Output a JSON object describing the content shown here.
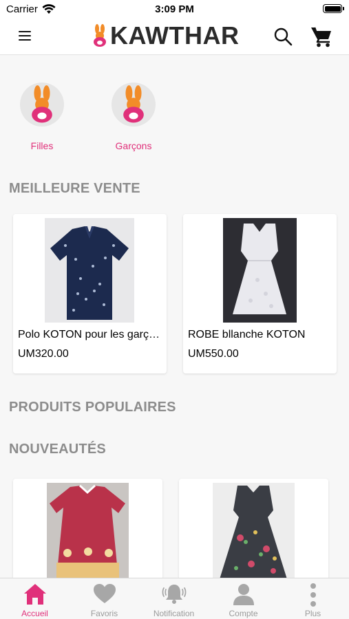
{
  "status_bar": {
    "carrier": "Carrier",
    "time": "3:09 PM"
  },
  "header": {
    "brand": "KAWTHAR",
    "menu_icon": "hamburger-menu-icon",
    "search_icon": "search-icon",
    "cart_icon": "cart-icon"
  },
  "categories": [
    {
      "label": "Filles",
      "icon": "bunny-logo-icon"
    },
    {
      "label": "Garçons",
      "icon": "bunny-logo-icon"
    }
  ],
  "sections": {
    "best_sellers": "MEILLEURE VENTE",
    "popular": "PRODUITS POPULAIRES",
    "new_arrivals": "NOUVEAUTÉS"
  },
  "best_sellers": [
    {
      "title": "Polo KOTON pour les garçons",
      "price": "UM320.00",
      "image": "navy-polo-shirt"
    },
    {
      "title": "ROBE bllanche  KOTON",
      "price": "UM550.00",
      "image": "white-dress"
    }
  ],
  "new_arrivals": [
    {
      "image": "red-girls-dress"
    },
    {
      "image": "floral-dark-dress"
    }
  ],
  "tab_bar": [
    {
      "label": "Accueil",
      "icon": "home-icon",
      "active": true
    },
    {
      "label": "Favoris",
      "icon": "heart-icon",
      "active": false
    },
    {
      "label": "Notification",
      "icon": "bell-icon",
      "active": false
    },
    {
      "label": "Compte",
      "icon": "person-icon",
      "active": false
    },
    {
      "label": "Plus",
      "icon": "more-vertical-icon",
      "active": false
    }
  ],
  "colors": {
    "accent": "#e0307a",
    "brand_orange": "#f28c28",
    "section_gray": "#8c8c8c",
    "inactive_tab": "#9a9a9a"
  }
}
